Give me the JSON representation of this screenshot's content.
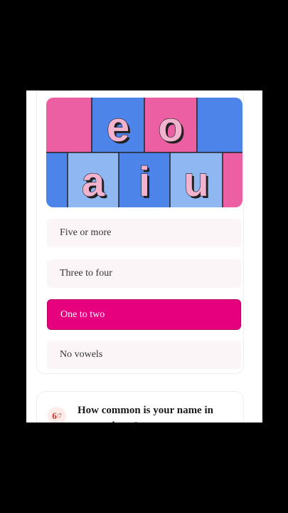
{
  "banner": {
    "top_letters": [
      "e",
      "o"
    ],
    "bottom_letters": [
      "a",
      "i",
      "u"
    ],
    "colors": {
      "pink": "#ec5fa3",
      "blue": "#4c84ea",
      "light_blue": "#8fb7f2",
      "letter_fill": "#f2b3cf"
    }
  },
  "options": [
    {
      "label": "Five or more",
      "selected": false
    },
    {
      "label": "Three to four",
      "selected": false
    },
    {
      "label": "One to two",
      "selected": true
    },
    {
      "label": "No vowels",
      "selected": false
    }
  ],
  "next_question": {
    "number": "6",
    "total": "/7",
    "text": "How common is your name in your culture?"
  },
  "accent_color": "#e6007e"
}
